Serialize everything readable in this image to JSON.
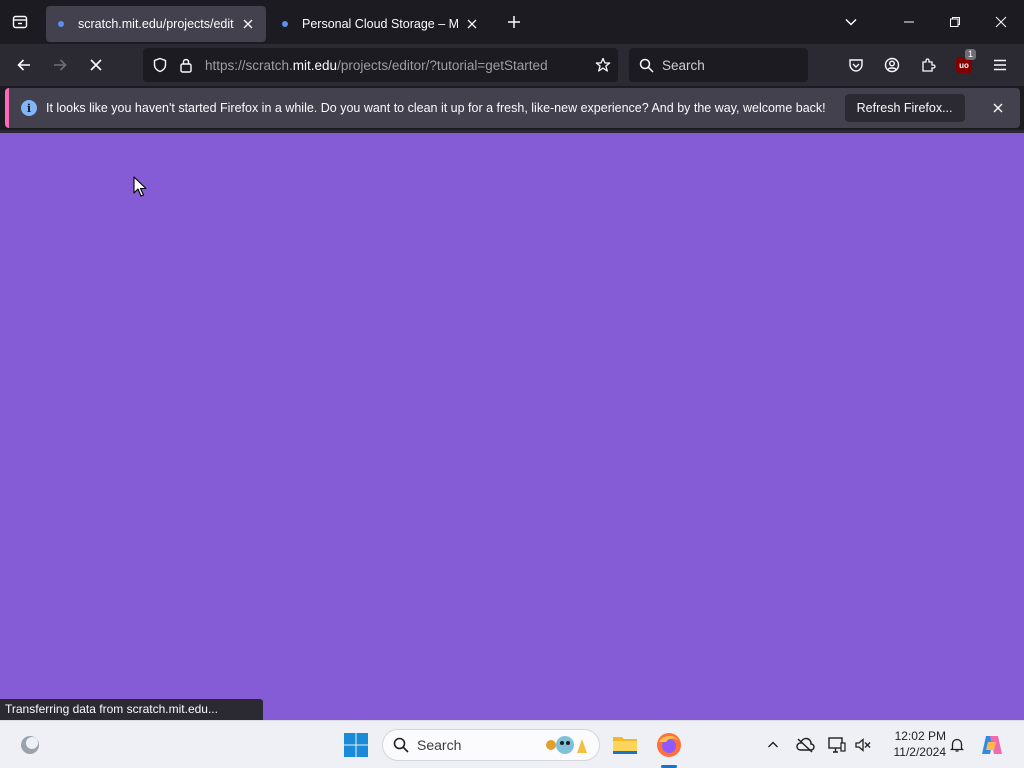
{
  "browser": {
    "tabs": [
      {
        "title": "scratch.mit.edu/projects/editor/?tutorial=getStarted",
        "active": true
      },
      {
        "title": "Personal Cloud Storage – Microsoft OneDrive",
        "active": false
      }
    ],
    "url": {
      "prefix": "https://scratch.",
      "domain": "mit.edu",
      "path": "/projects/editor/?tutorial=getStarted"
    },
    "search_placeholder": "Search",
    "extension_badge": "1"
  },
  "notification": {
    "message": "It looks like you haven't started Firefox in a while. Do you want to clean it up for a fresh, like-new experience? And by the way, welcome back!",
    "button_label": "Refresh Firefox..."
  },
  "page": {
    "background_color": "#855cd6",
    "status_text": "Transferring data from scratch.mit.edu..."
  },
  "taskbar": {
    "search_placeholder": "Search",
    "time": "12:02 PM",
    "date": "11/2/2024"
  }
}
